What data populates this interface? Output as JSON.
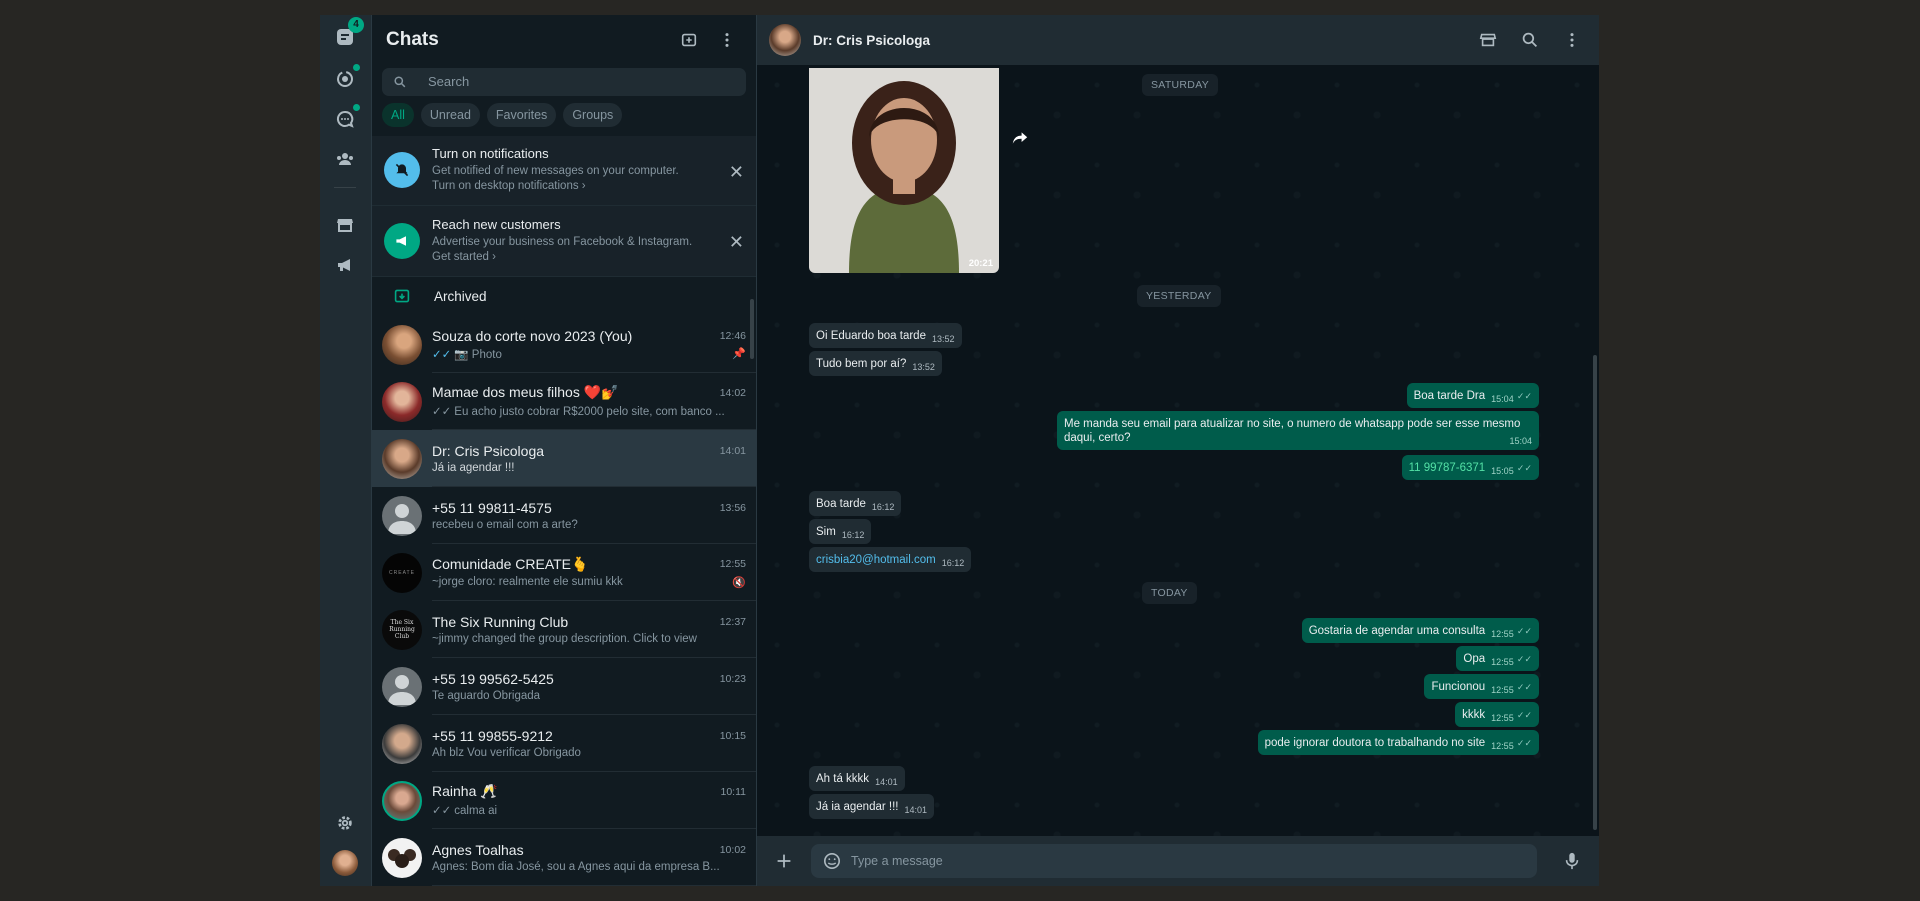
{
  "rail": {
    "chats_badge": "4"
  },
  "sidebar": {
    "title": "Chats",
    "search_placeholder": "Search",
    "filters": [
      {
        "label": "All"
      },
      {
        "label": "Unread"
      },
      {
        "label": "Favorites"
      },
      {
        "label": "Groups"
      }
    ],
    "notifications_banner": {
      "title": "Turn on notifications",
      "line1": "Get notified of new messages on your computer.",
      "line2": "Turn on desktop notifications ›"
    },
    "customers_banner": {
      "title": "Reach new customers",
      "line1": "Advertise your business on Facebook & Instagram.",
      "line2": "Get started ›"
    },
    "archived_label": "Archived",
    "chats": [
      {
        "name": "Souza do corte novo 2023 (You)",
        "time": "12:46",
        "preview": "📷 Photo",
        "ticks": "✓✓",
        "meta": "pin"
      },
      {
        "name": "Mamae dos meus filhos ❤️💅",
        "time": "14:02",
        "preview": "Eu acho justo cobrar R$2000 pelo site, com banco ...",
        "ticks": "✓✓"
      },
      {
        "name": "Dr: Cris Psicologa",
        "time": "14:01",
        "preview": "Já ia agendar !!!"
      },
      {
        "name": "+55 11 99811-4575",
        "time": "13:56",
        "preview": "recebeu o email com a arte?"
      },
      {
        "name": "Comunidade CREATE🫰",
        "time": "12:55",
        "preview": "~jorge cloro: realmente ele sumiu kkk",
        "meta": "muted"
      },
      {
        "name": "The Six Running Club",
        "time": "12:37",
        "preview": "~jimmy changed the group description. Click to view"
      },
      {
        "name": "+55 19 99562-5425",
        "time": "10:23",
        "preview": "Te aguardo Obrigada"
      },
      {
        "name": "+55 11 99855-9212",
        "time": "10:15",
        "preview": "Ah blz Vou verificar Obrigado"
      },
      {
        "name": "Rainha 🥂",
        "time": "10:11",
        "preview": "calma ai",
        "ticks": "✓✓"
      },
      {
        "name": "Agnes Toalhas",
        "time": "10:02",
        "preview": "Agnes:  Bom dia José, sou a Agnes aqui da empresa B..."
      }
    ]
  },
  "conversation": {
    "contact_name": "Dr: Cris Psicologa",
    "photo_time": "20:21",
    "date_labels": [
      "SATURDAY",
      "YESTERDAY",
      "TODAY"
    ],
    "messages": [
      {
        "dir": "in",
        "text": "Oi Eduardo boa tarde",
        "time": "13:52"
      },
      {
        "dir": "in",
        "text": "Tudo bem por aí?",
        "time": "13:52"
      },
      {
        "dir": "out",
        "text": "Boa tarde Dra",
        "time": "15:04"
      },
      {
        "dir": "out",
        "text": "Me manda seu email para atualizar no site, o numero de whatsapp pode ser esse mesmo daqui, certo?",
        "time": "15:04"
      },
      {
        "dir": "out",
        "text": "11 99787-6371",
        "time": "15:05"
      },
      {
        "dir": "in",
        "text": "Boa tarde",
        "time": "16:12"
      },
      {
        "dir": "in",
        "text": "Sim",
        "time": "16:12"
      },
      {
        "dir": "in",
        "text": "crisbia20@hotmail.com",
        "time": "16:12"
      },
      {
        "dir": "out",
        "text": "Gostaria de agendar uma consulta",
        "time": "12:55"
      },
      {
        "dir": "out",
        "text": "Opa",
        "time": "12:55"
      },
      {
        "dir": "out",
        "text": "Funcionou",
        "time": "12:55"
      },
      {
        "dir": "out",
        "text": "kkkk",
        "time": "12:55"
      },
      {
        "dir": "out",
        "text": "pode ignorar doutora to trabalhando no site",
        "time": "12:55"
      },
      {
        "dir": "in",
        "text": "Ah tá kkkk",
        "time": "14:01"
      },
      {
        "dir": "in",
        "text": "Já ia agendar !!!",
        "time": "14:01"
      }
    ]
  },
  "composer": {
    "placeholder": "Type a message"
  },
  "colors": {
    "accent": "#00a884",
    "outgoing_bubble": "#005c4b",
    "incoming_bubble": "#202c33",
    "panel": "#111b21",
    "header": "#202c33"
  }
}
